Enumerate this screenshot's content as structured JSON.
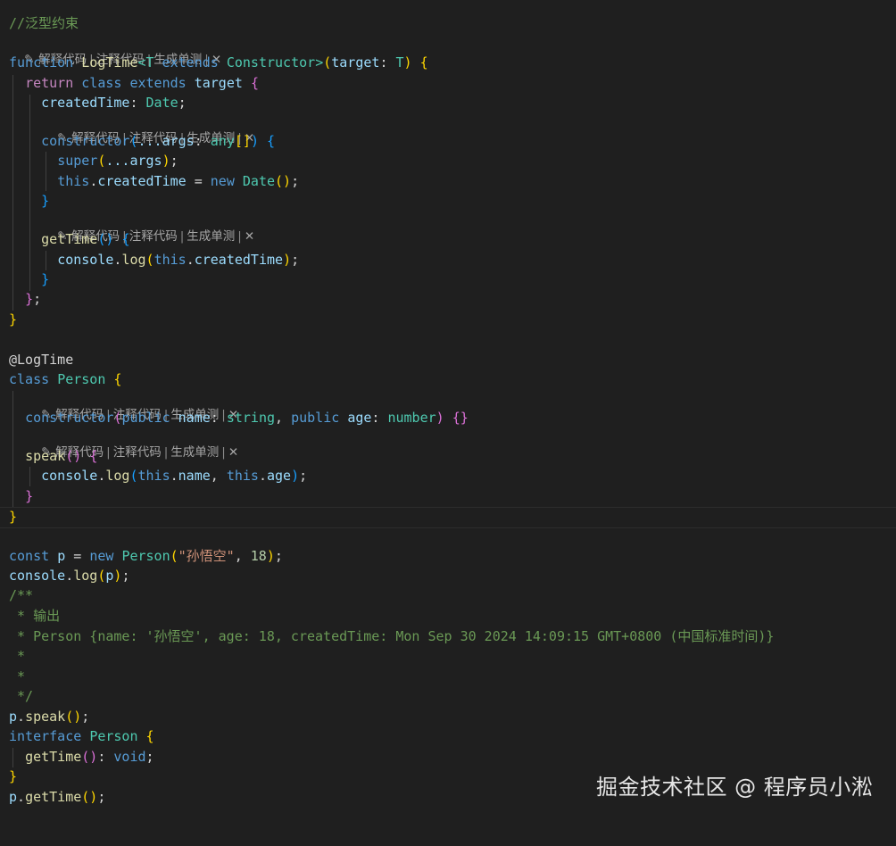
{
  "editor": {
    "theme_colors": {
      "background": "#1f1f1f",
      "comment": "#6a9955",
      "keyword": "#569cd6",
      "control_keyword": "#c586c0",
      "function": "#dcdcaa",
      "type": "#4ec9b0",
      "variable": "#9cdcfe",
      "string": "#ce9178",
      "number": "#b5cea8"
    },
    "codelens": {
      "icon": "pen-icon",
      "explain": "解释代码",
      "comment": "注释代码",
      "test": "生成单测",
      "separator": "|",
      "close": "✕"
    },
    "lines": {
      "l1_comment": "//泛型约束",
      "kw_function": "function",
      "fn_logtime": "LogTime",
      "generic_T": "T",
      "kw_extends": "extends",
      "type_constructor": "Constructor",
      "param_target": "target",
      "type_T": "T",
      "kw_return": "return",
      "kw_class": "class",
      "var_target": "target",
      "prop_createdTime": "createdTime",
      "type_Date": "Date",
      "kw_constructor": "constructor",
      "spread_args": "...args",
      "type_any": "any",
      "kw_super": "super",
      "kw_this": "this",
      "kw_new": "new",
      "fn_getTime": "getTime",
      "var_console": "console",
      "fn_log": "log",
      "decorator": "@LogTime",
      "class_person": "Person",
      "kw_public": "public",
      "param_name": "name",
      "type_string": "string",
      "param_age": "age",
      "type_number": "number",
      "fn_speak": "speak",
      "kw_const": "const",
      "var_p": "p",
      "str_sunwukong": "\"孙悟空\"",
      "num_18": "18",
      "doc_open": "/**",
      "doc_output": " * 输出",
      "doc_person": " * Person {name: '孙悟空', age: 18, createdTime: Mon Sep 30 2024 14:09:15 GMT+0800 (中国标准时间)}",
      "doc_star": " *",
      "doc_close": " */",
      "kw_interface": "interface",
      "type_void": "void"
    }
  },
  "watermark": {
    "text": "掘金技术社区 @ 程序员小淞"
  }
}
